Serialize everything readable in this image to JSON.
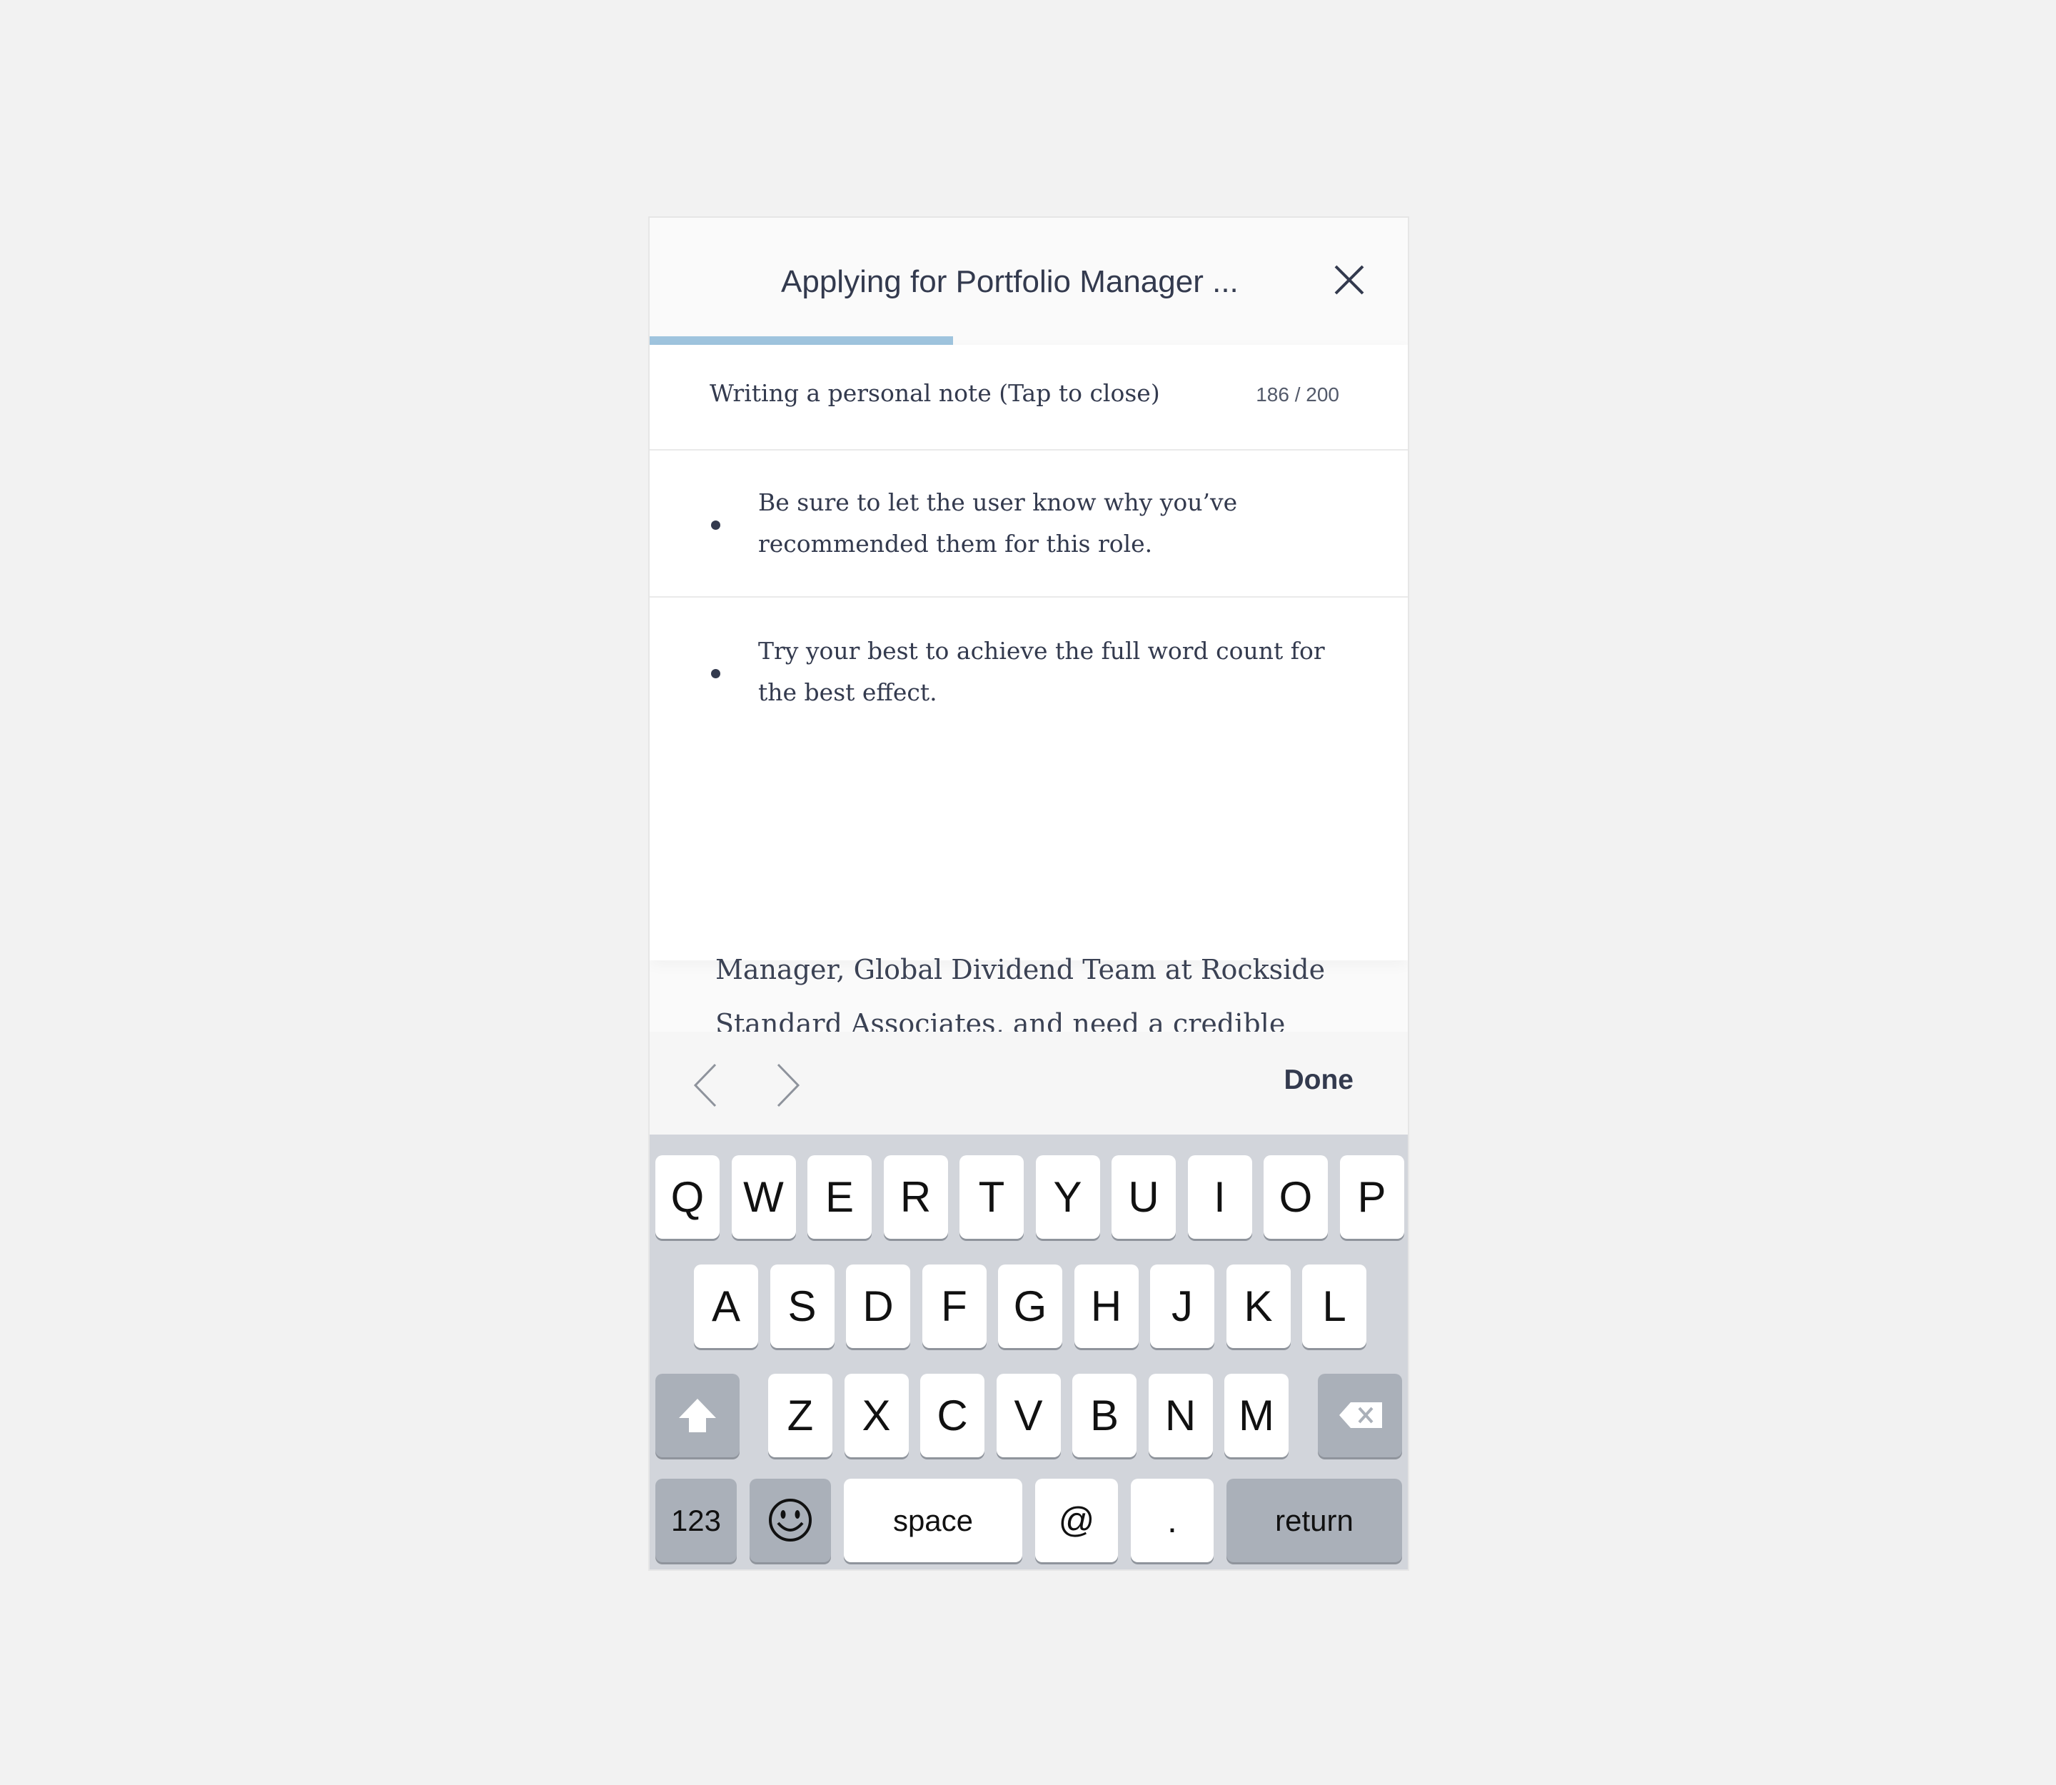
{
  "header": {
    "title": "Applying for Portfolio Manager ...",
    "close_icon": "close-icon",
    "progress": 0.4
  },
  "note": {
    "label": "Writing a personal note (Tap to close)",
    "counter": "186 / 200",
    "tips": [
      "Be sure to let the user know why you’ve recommended them for this role.",
      "Try your best to achieve the full word count for the best effect."
    ]
  },
  "message": {
    "text": "Manager, Global Dividend Team at Rockside\nStandard Associates, and need a credible\nendorsement to be considered. I’d be grateful\nfor your help"
  },
  "accessory": {
    "prev_icon": "chevron-left-icon",
    "next_icon": "chevron-right-icon",
    "done_label": "Done"
  },
  "keyboard": {
    "row1": [
      "Q",
      "W",
      "E",
      "R",
      "T",
      "Y",
      "U",
      "I",
      "O",
      "P"
    ],
    "row2": [
      "A",
      "S",
      "D",
      "F",
      "G",
      "H",
      "J",
      "K",
      "L"
    ],
    "row3": [
      "Z",
      "X",
      "C",
      "V",
      "B",
      "N",
      "M"
    ],
    "shift_icon": "shift-icon",
    "backspace_icon": "backspace-icon",
    "numbers_label": "123",
    "emoji_icon": "emoji-icon",
    "space_label": "space",
    "at_label": "@",
    "period_label": ".",
    "return_label": "return"
  },
  "colors": {
    "accent": "#9fc4de",
    "text": "#333a4e",
    "keyboard_bg": "#d2d5db"
  }
}
